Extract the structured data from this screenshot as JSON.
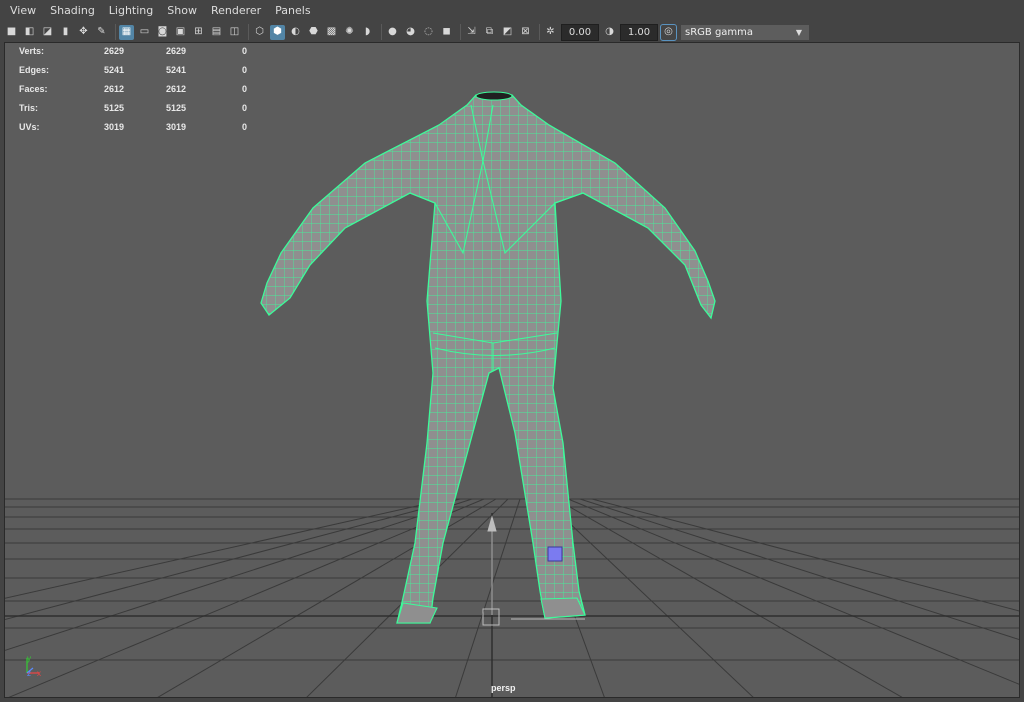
{
  "menu": {
    "items": [
      "View",
      "Shading",
      "Lighting",
      "Show",
      "Renderer",
      "Panels"
    ]
  },
  "toolbar": {
    "exposure_value": "0.00",
    "gamma_value": "1.00",
    "color_space": "sRGB gamma"
  },
  "hud": {
    "rows": [
      {
        "label": "Verts:",
        "c1": "2629",
        "c2": "2629",
        "c3": "0"
      },
      {
        "label": "Edges:",
        "c1": "5241",
        "c2": "5241",
        "c3": "0"
      },
      {
        "label": "Faces:",
        "c1": "2612",
        "c2": "2612",
        "c3": "0"
      },
      {
        "label": "Tris:",
        "c1": "5125",
        "c2": "5125",
        "c3": "0"
      },
      {
        "label": "UVs:",
        "c1": "3019",
        "c2": "3019",
        "c3": "0"
      }
    ]
  },
  "viewport": {
    "camera": "persp",
    "axes": {
      "x": "x",
      "y": "y",
      "z": "z"
    }
  },
  "colors": {
    "wireframe": "#3dfb9a",
    "mesh": "#8f8f8f",
    "background": "#5c5c5c",
    "grid": "#3e3e3e",
    "selection": "#7b7bf0"
  }
}
